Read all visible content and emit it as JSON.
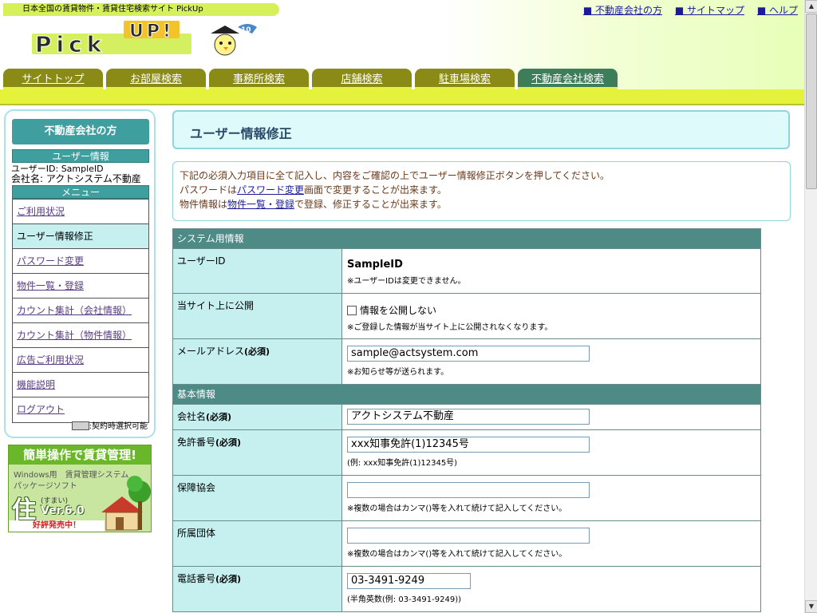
{
  "header": {
    "tagline": "日本全国の賃貸物件・賃貸住宅検索サイト PickUp",
    "logo_text": "Pick Up!",
    "top_links": [
      {
        "label": "■ 不動産会社の方"
      },
      {
        "label": "■ サイトマップ"
      },
      {
        "label": "■ ヘルプ"
      }
    ],
    "tabs": [
      {
        "label": "サイトトップ"
      },
      {
        "label": "お部屋検索"
      },
      {
        "label": "事務所検索"
      },
      {
        "label": "店舗検索"
      },
      {
        "label": "駐車場検索"
      },
      {
        "label": "不動産会社検索"
      }
    ]
  },
  "sidebar": {
    "title": "不動産会社の方",
    "user_info_heading": "ユーザー情報",
    "user_id_line": "ユーザーID: SampleID",
    "company_line": "会社名: アクトシステム不動産",
    "menu_heading": "メニュー",
    "menu": [
      {
        "label": "ご利用状況"
      },
      {
        "label": "ユーザー情報修正"
      },
      {
        "label": "パスワード変更"
      },
      {
        "label": "物件一覧・登録"
      },
      {
        "label": "カウント集計（会社情報）"
      },
      {
        "label": "カウント集計（物件情報）"
      },
      {
        "label": "広告ご利用状況"
      },
      {
        "label": "機能説明"
      },
      {
        "label": "ログアウト"
      }
    ],
    "legend": ":契約時選択可能"
  },
  "ad": {
    "headline": "簡単操作で賃貸管理!",
    "line1": "Windows用　賃貸管理システム",
    "line2": "パッケージソフト",
    "kanji": "住",
    "reading": "(すまい)",
    "version": "Ver.6.0",
    "release": "好評発売中！"
  },
  "main": {
    "title": "ユーザー情報修正",
    "notice": {
      "line1": "下記の必須入力項目に全て記入し、内容をご確認の上でユーザー情報修正ボタンを押してください。",
      "line2_pre": "パスワードは",
      "line2_link": "パスワード変更",
      "line2_post": "画面で変更することが出来ます。",
      "line3_pre": "物件情報は",
      "line3_link": "物件一覧・登録",
      "line3_post": "で登録、修正することが出来ます。"
    },
    "sections": {
      "system": "システム用情報",
      "basic": "基本情報"
    },
    "required_mark": "(必須)",
    "fields": {
      "user_id": {
        "label": "ユーザーID",
        "value": "SampleID",
        "note": "※ユーザーIDは変更できません。"
      },
      "public": {
        "label": "当サイト上に公開",
        "checkbox_label": "情報を公開しない",
        "note": "※ご登録した情報が当サイト上に公開されなくなります。"
      },
      "email": {
        "label": "メールアドレス",
        "value": "sample@actsystem.com",
        "note": "※お知らせ等が送られます。"
      },
      "company": {
        "label": "会社名",
        "value": "アクトシステム不動産"
      },
      "license": {
        "label": "免許番号",
        "value": "xxx知事免許(1)12345号",
        "note": "(例: xxx知事免許(1)12345号)"
      },
      "guarantee": {
        "label": "保障協会",
        "value": "",
        "note": "※複数の場合はカンマ()等を入れて続けて記入してください。"
      },
      "affiliation": {
        "label": "所属団体",
        "value": "",
        "note": "※複数の場合はカンマ()等を入れて続けて記入してください。"
      },
      "phone": {
        "label": "電話番号",
        "value": "03-3491-9249",
        "note": "(半角英数(例: 03-3491-9249))"
      }
    }
  }
}
